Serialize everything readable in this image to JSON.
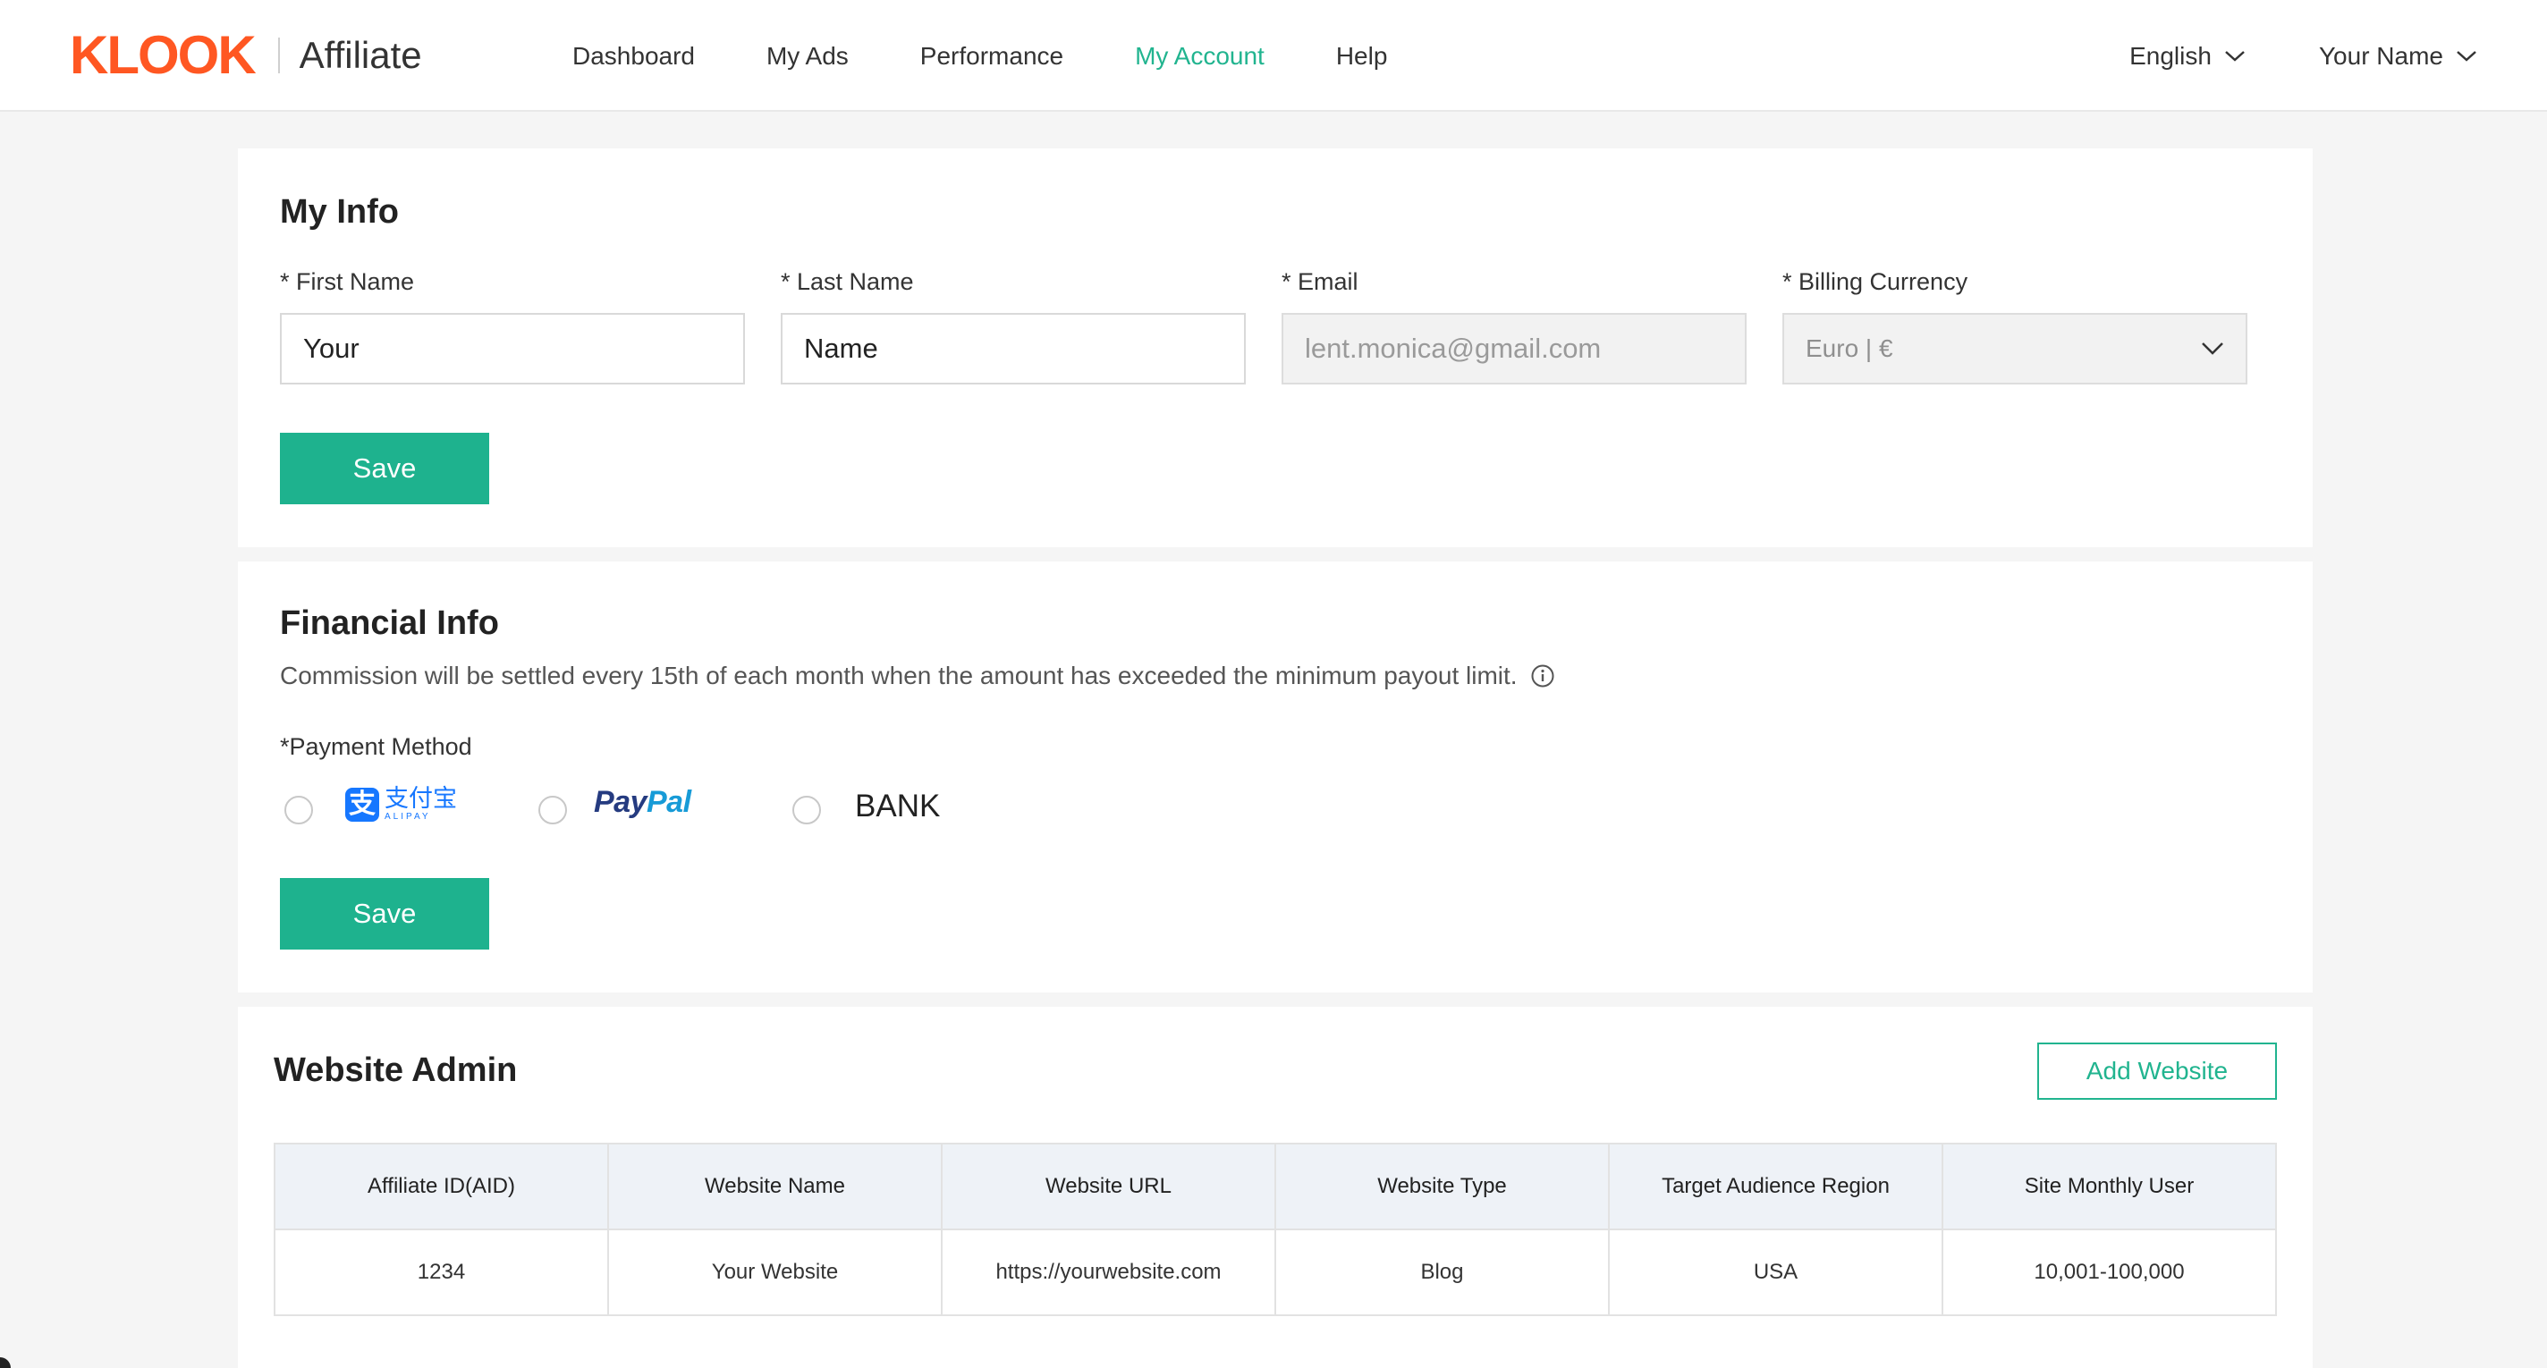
{
  "header": {
    "logo": "KLOOK",
    "logo_sub": "Affiliate",
    "nav": [
      {
        "label": "Dashboard"
      },
      {
        "label": "My Ads"
      },
      {
        "label": "Performance"
      },
      {
        "label": "My Account"
      },
      {
        "label": "Help"
      }
    ],
    "language": "English",
    "user": "Your Name",
    "active_color": "#21b48f",
    "brand_color": "#ff5722"
  },
  "my_info": {
    "title": "My Info",
    "first_name_label": "* First Name",
    "first_name_value": "Your",
    "last_name_label": "* Last Name",
    "last_name_value": "Name",
    "email_label": "* Email",
    "email_value": "lent.monica@gmail.com",
    "currency_label": "* Billing Currency",
    "currency_value": "Euro | €",
    "save_label": "Save"
  },
  "financial_info": {
    "title": "Financial Info",
    "description": "Commission will be settled every 15th of each month when the amount has exceeded the minimum payout limit.",
    "payment_label": "*Payment Method",
    "methods": {
      "alipay_cn": "支付宝",
      "alipay_en": "ALIPAY",
      "paypal_a": "Pay",
      "paypal_b": "Pal",
      "bank": "BANK"
    },
    "save_label": "Save"
  },
  "website_admin": {
    "title": "Website Admin",
    "add_label": "Add Website",
    "columns": [
      "Affiliate ID(AID)",
      "Website Name",
      "Website URL",
      "Website Type",
      "Target Audience Region",
      "Site Monthly User"
    ],
    "rows": [
      [
        "1234",
        "Your Website",
        "https://yourwebsite.com",
        "Blog",
        "USA",
        "10,001-100,000"
      ]
    ]
  }
}
